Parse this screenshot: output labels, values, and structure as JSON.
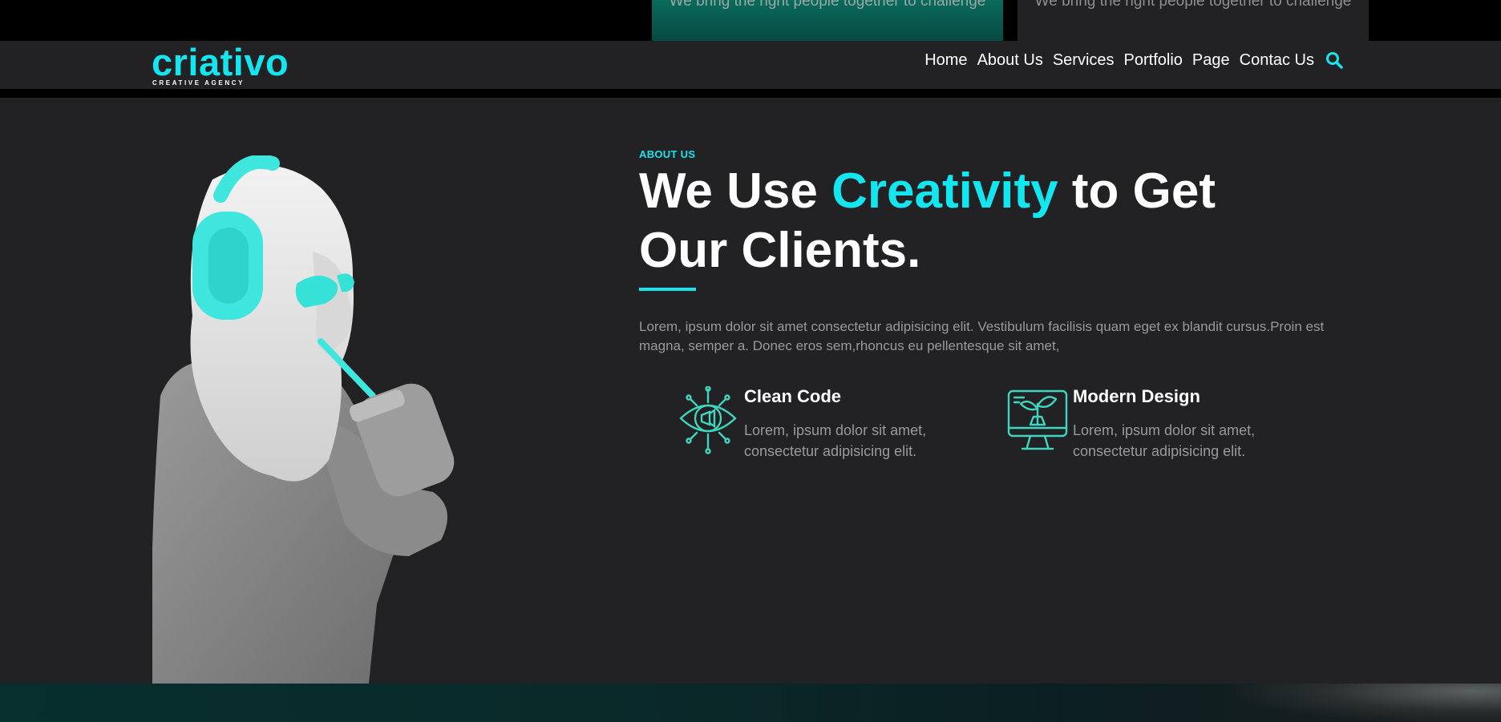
{
  "top_cards": [
    {
      "text": "We bring the right people together to challenge"
    },
    {
      "text": "We bring the right people together to challenge"
    }
  ],
  "brand": {
    "name": "criativo",
    "tagline": "CREATIVE AGENCY"
  },
  "nav": {
    "items": [
      "Home",
      "About Us",
      "Services",
      "Portfolio",
      "Page",
      "Contac Us"
    ]
  },
  "about": {
    "eyebrow": "ABOUT US",
    "headline_pre": "We Use ",
    "headline_accent": "Creativity",
    "headline_post": " to Get Our Clients.",
    "intro": "Lorem, ipsum dolor sit amet consectetur adipisicing elit. Vestibulum facilisis quam eget ex blandit cursus.Proin est magna, semper a. Donec eros sem,rhoncus eu pellentesque sit amet,",
    "features": [
      {
        "title": "Clean Code",
        "desc": "Lorem, ipsum dolor sit amet, consectetur adipisicing elit.",
        "icon": "eye-megaphone-icon"
      },
      {
        "title": "Modern Design",
        "desc": "Lorem, ipsum dolor sit amet, consectetur adipisicing elit.",
        "icon": "monitor-plant-icon"
      }
    ]
  },
  "colors": {
    "accent": "#13e6ee",
    "background": "#222124",
    "icon": "#3fd6c0"
  }
}
